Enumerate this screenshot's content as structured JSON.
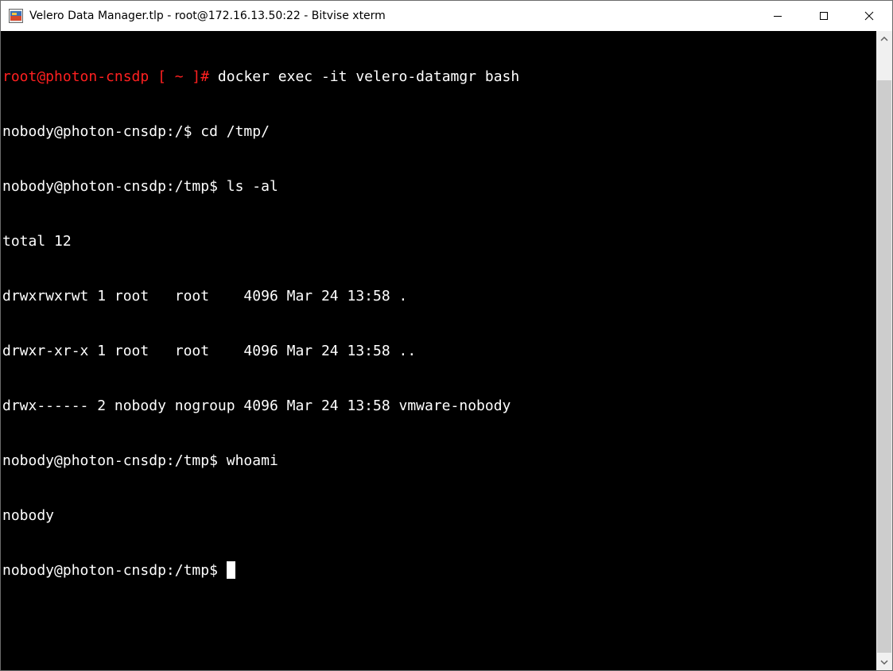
{
  "window": {
    "title": "Velero Data Manager.tlp - root@172.16.13.50:22 - Bitvise xterm"
  },
  "terminal": {
    "lines": [
      {
        "prompt": "root@photon-cnsdp [ ~ ]#",
        "command": " docker exec -it velero-datamgr bash"
      },
      {
        "prompt": "",
        "command": "nobody@photon-cnsdp:/$ cd /tmp/"
      },
      {
        "prompt": "",
        "command": "nobody@photon-cnsdp:/tmp$ ls -al"
      },
      {
        "prompt": "",
        "command": "total 12"
      },
      {
        "prompt": "",
        "command": "drwxrwxrwt 1 root   root    4096 Mar 24 13:58 ."
      },
      {
        "prompt": "",
        "command": "drwxr-xr-x 1 root   root    4096 Mar 24 13:58 .."
      },
      {
        "prompt": "",
        "command": "drwx------ 2 nobody nogroup 4096 Mar 24 13:58 vmware-nobody"
      },
      {
        "prompt": "",
        "command": "nobody@photon-cnsdp:/tmp$ whoami"
      },
      {
        "prompt": "",
        "command": "nobody"
      },
      {
        "prompt": "",
        "command": "nobody@photon-cnsdp:/tmp$ "
      }
    ]
  },
  "colors": {
    "background": "#000000",
    "foreground": "#ffffff",
    "root_prompt": "#ff2020"
  },
  "icons": {
    "app": "bitvise-xterm-icon",
    "minimize": "minimize-icon",
    "maximize": "maximize-icon",
    "close": "close-icon",
    "scroll_up": "scroll-up-arrow-icon",
    "scroll_down": "scroll-down-arrow-icon"
  }
}
